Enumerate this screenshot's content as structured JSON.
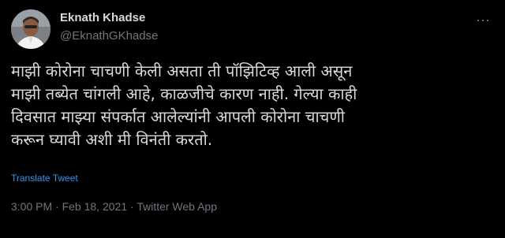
{
  "author": {
    "name": "Eknath Khadse",
    "handle": "@EknathGKhadse"
  },
  "menu": {
    "icon": "more-dots-icon",
    "glyph": "···"
  },
  "tweet": {
    "lines": [
      "माझी कोरोना चाचणी केली असता ती पॉझिटिव्ह आली  असून",
      "माझी तब्येत चांगली आहे, काळजीचे कारण नाही. गेल्या काही",
      "दिवसात माझ्या संपर्कात आलेल्यांनी आपली कोरोना चाचणी",
      "करून घ्यावी अशी मी विनंती करतो."
    ],
    "translate_label": "Translate Tweet"
  },
  "meta": {
    "time": "3:00 PM",
    "sep1": " · ",
    "date": "Feb 18, 2021",
    "sep2": " · ",
    "source": "Twitter Web App"
  },
  "colors": {
    "background": "#000000",
    "text": "#d9d9d9",
    "secondary": "#6e767d",
    "link": "#1d9bf0"
  }
}
